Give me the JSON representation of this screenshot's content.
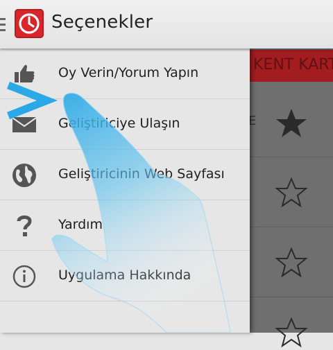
{
  "actionbar": {
    "title": "Seçenekler",
    "icons": {
      "up": "drawer-indicator-icon",
      "app": "clock-icon"
    }
  },
  "background": {
    "header_text": "KENT KART",
    "row_text": "E",
    "stars": [
      "star-filled-icon",
      "star-outline-icon",
      "star-outline-icon",
      "star-outline-icon"
    ]
  },
  "drawer": {
    "items": [
      {
        "label": "Oy Verin/Yorum Yapın",
        "icon": "thumbs-up-icon"
      },
      {
        "label": "Geliştiriciye Ulaşın",
        "icon": "mail-icon"
      },
      {
        "label": "Geliştiricinin Web Sayfası",
        "icon": "globe-icon"
      },
      {
        "label": "Yardım",
        "icon": "question-icon"
      },
      {
        "label": "Uygulama Hakkında",
        "icon": "info-icon"
      }
    ]
  },
  "overlay": {
    "icons": [
      "swipe-chevron-icon",
      "pointing-hand-icon"
    ],
    "colors": {
      "accent": "#2aa9e6"
    }
  }
}
